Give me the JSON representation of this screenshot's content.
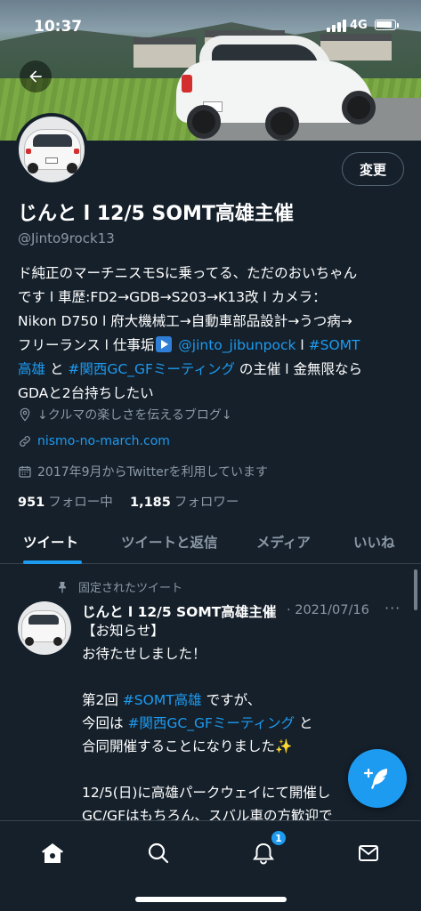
{
  "status_bar": {
    "time": "10:37",
    "network": "4G"
  },
  "header": {
    "edit_button": "変更"
  },
  "profile": {
    "name": "じんと l 12/5 SOMT高雄主催",
    "handle": "@Jinto9rock13",
    "bio_lines": [
      "ド純正のマーチニスモSに乗ってる、ただのおいちゃん",
      "です l 車歴:FD2→GDB→S203→K13改 l カメラ：",
      "Nikon D750 l 府大機械工→自動車部品設計→うつ病→",
      "フリーランス l 仕事垢"
    ],
    "bio_mention": "@jinto_jibunpock",
    "bio_sep": " l ",
    "bio_hashtag1_a": "#SOMT",
    "bio_hashtag1_b": "高雄",
    "bio_and": " と ",
    "bio_hashtag2": "#関西GC_GFミーティング",
    "bio_tail": " の主催 l 金無限なら",
    "bio_last": "GDAと2台持ちしたい",
    "location": "↓クルマの楽しさを伝えるブログ↓",
    "website": "nismo-no-march.com",
    "joined": "2017年9月からTwitterを利用しています",
    "following_count": "951",
    "following_label": "フォロー中",
    "followers_count": "1,185",
    "followers_label": "フォロワー"
  },
  "tabs": [
    "ツイート",
    "ツイートと返信",
    "メディア",
    "いいね"
  ],
  "pinned_tweet": {
    "pinned_label": "固定されたツイート",
    "author": "じんと l 12/5 SOMT高雄主催",
    "date": "· 2021/07/16",
    "more": "···",
    "line1": "【お知らせ】",
    "line2": "お待たせしました！",
    "line3_pre": "第2回 ",
    "line3_tag": "#SOMT高雄",
    "line3_post": " ですが、",
    "line4_pre": "今回は ",
    "line4_tag": "#関西GC_GFミーティング",
    "line4_post": " と",
    "line5": "合同開催することになりました",
    "line5_emoji": "✨",
    "line6": "12/5(日)に高雄パークウェイにて開催し",
    "line7": "GC/GFはもちろん、スバル車の方歓迎で"
  },
  "bottom_nav": {
    "notification_badge": "1"
  },
  "colors": {
    "background": "#15202b",
    "accent": "#1d9bf0",
    "muted": "#8b98a5",
    "divider": "#38444d"
  }
}
